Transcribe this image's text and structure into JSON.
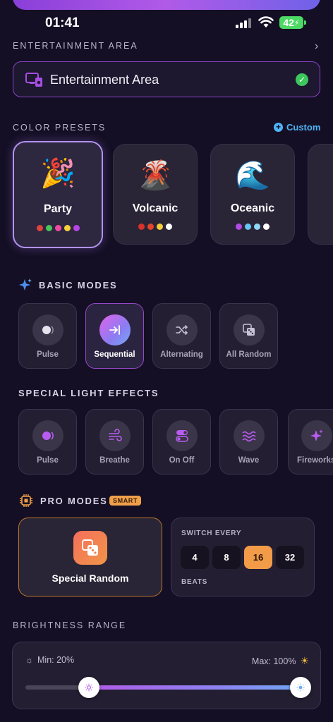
{
  "status_bar": {
    "time": "01:41",
    "battery": "42"
  },
  "entertainment": {
    "section_label": "ENTERTAINMENT AREA",
    "selected_area": "Entertainment Area"
  },
  "color_presets": {
    "section_label": "COLOR PRESETS",
    "custom_label": "Custom",
    "items": [
      {
        "name": "Party",
        "emoji": "🎉",
        "dots": [
          "#e0433c",
          "#4cc35a",
          "#f04aa0",
          "#f5d23a",
          "#b447e4"
        ]
      },
      {
        "name": "Volcanic",
        "emoji": "🌋",
        "dots": [
          "#d8322a",
          "#e3452e",
          "#f2cc3b",
          "#ffffff"
        ]
      },
      {
        "name": "Oceanic",
        "emoji": "🌊",
        "dots": [
          "#b04be3",
          "#66c6f2",
          "#8fd8f5",
          "#ffffff"
        ]
      }
    ]
  },
  "basic_modes": {
    "section_label": "BASIC MODES",
    "items": [
      {
        "label": "Pulse",
        "icon": "pulse-icon"
      },
      {
        "label": "Sequential",
        "icon": "sequential-icon",
        "active": true
      },
      {
        "label": "Alternating",
        "icon": "shuffle-icon"
      },
      {
        "label": "All Random",
        "icon": "dice-icon"
      }
    ]
  },
  "special_effects": {
    "section_label": "SPECIAL LIGHT EFFECTS",
    "items": [
      {
        "label": "Pulse",
        "icon": "pulse-icon"
      },
      {
        "label": "Breathe",
        "icon": "wind-icon"
      },
      {
        "label": "On Off",
        "icon": "toggle-icon"
      },
      {
        "label": "Wave",
        "icon": "wave-icon"
      },
      {
        "label": "Fireworks",
        "icon": "sparkle-icon"
      }
    ]
  },
  "pro_modes": {
    "section_label": "PRO MODES",
    "badge": "SMART",
    "card_label": "Special Random",
    "switch_title": "SWITCH EVERY",
    "switch_footer": "BEATS",
    "beats": [
      "4",
      "8",
      "16",
      "32"
    ],
    "selected_beat": "16"
  },
  "brightness": {
    "section_label": "BRIGHTNESS RANGE",
    "min_label": "Min: 20%",
    "max_label": "Max: 100%",
    "min_value": 20,
    "max_value": 100
  },
  "colors": {
    "background": "#140f24",
    "accent_purple": "#9647c9",
    "accent_orange": "#f29b48",
    "link_blue": "#4fb4f6",
    "success_green": "#3cc65c"
  }
}
